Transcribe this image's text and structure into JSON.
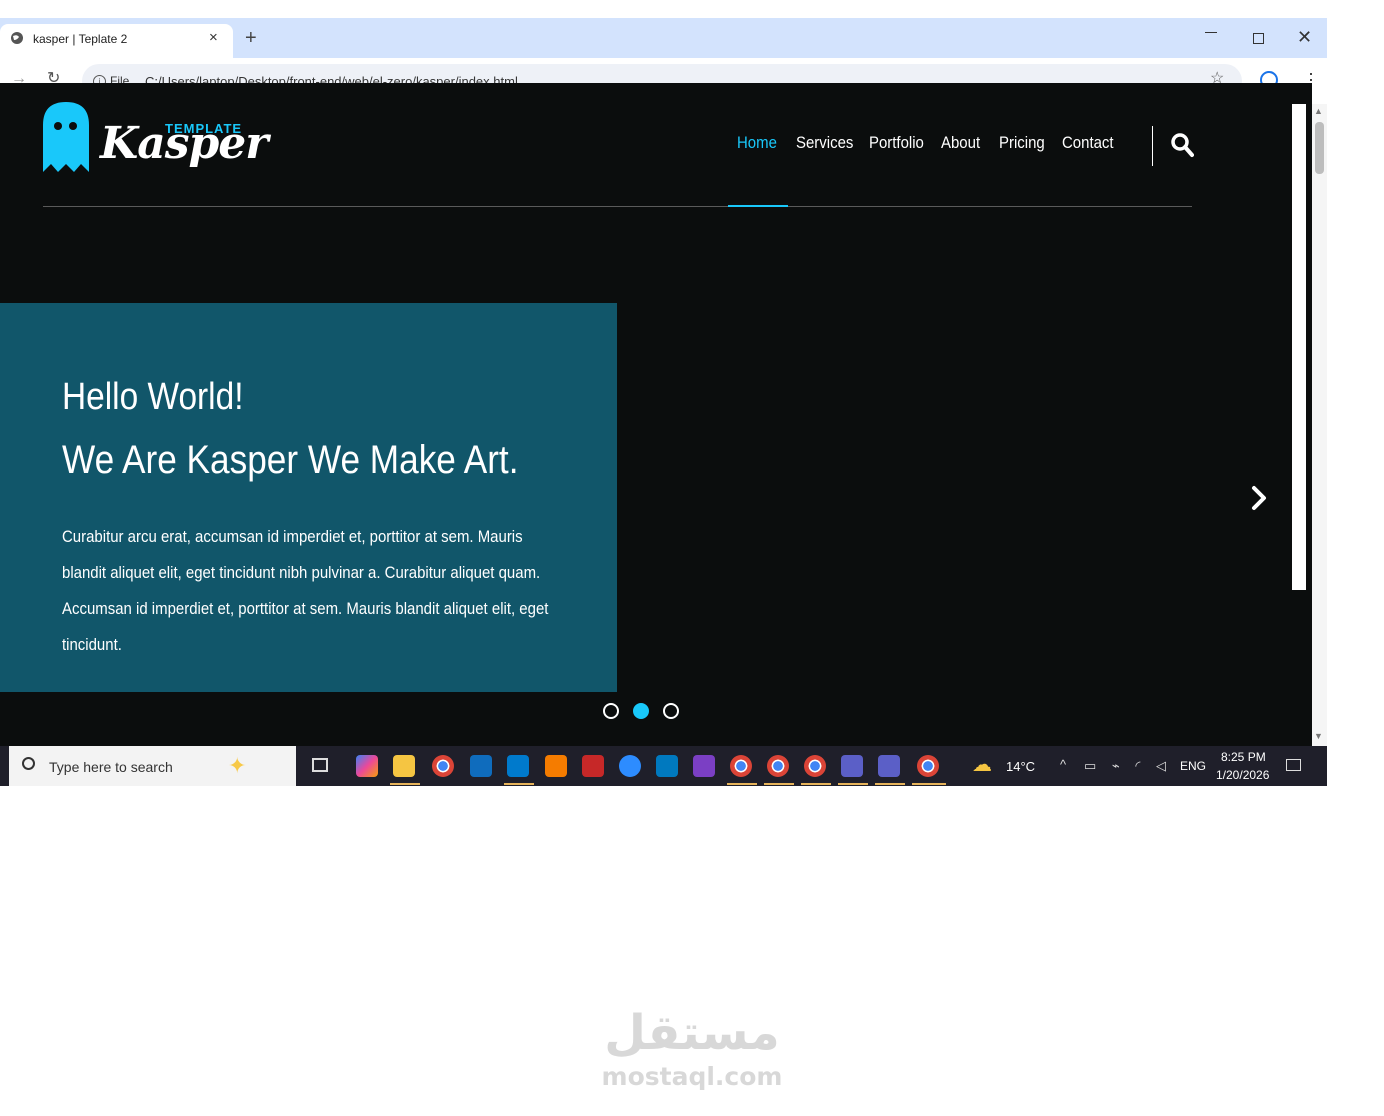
{
  "browser": {
    "tab_title": "kasper | Teplate 2",
    "close_glyph": "×",
    "new_tab_glyph": "+",
    "win_close_glyph": "✕",
    "file_label": "File",
    "url": "C:/Users/laptop/Desktop/front-end/web/el-zero/kasper/index.html",
    "back_glyph": "→",
    "reload_glyph": "↻",
    "star_glyph": "☆",
    "menu_glyph": "⋮"
  },
  "site": {
    "logo_template": "TEMPLATE",
    "logo_text": "Kasper",
    "accent_color": "#19c8fa",
    "hero_bg_color": "#11566a",
    "nav": [
      "Home",
      "Services",
      "Portfolio",
      "About",
      "Pricing",
      "Contact"
    ],
    "active_nav": "Home",
    "hero": {
      "title": "Hello World!",
      "subtitle": "We Are Kasper We Make Art.",
      "paragraph": "Curabitur arcu erat, accumsan id imperdiet et, porttitor at sem. Mauris blandit aliquet elit, eget tincidunt nibh pulvinar a. Curabitur aliquet quam. Accumsan id imperdiet et, porttitor at sem. Mauris blandit aliquet elit, eget tincidunt."
    },
    "slider_bullets_active": 2
  },
  "taskbar": {
    "search_placeholder": "Type here to search",
    "weather_temp": "14°C",
    "lang": "ENG",
    "time": "8:25 PM",
    "date": "1/20/2026",
    "pinned_icons": [
      "copilot-icon",
      "file-explorer-icon",
      "chrome-icon",
      "outlook-icon",
      "vscode-icon",
      "git-icon",
      "snipping-tool-icon",
      "zoom-icon",
      "trello-icon",
      "visual-studio-icon",
      "chrome-icon",
      "chrome-icon",
      "chrome-icon",
      "teams-icon",
      "teams-icon",
      "chrome-icon"
    ]
  },
  "watermark": {
    "arabic": "مستقل",
    "latin": "mostaql.com"
  }
}
